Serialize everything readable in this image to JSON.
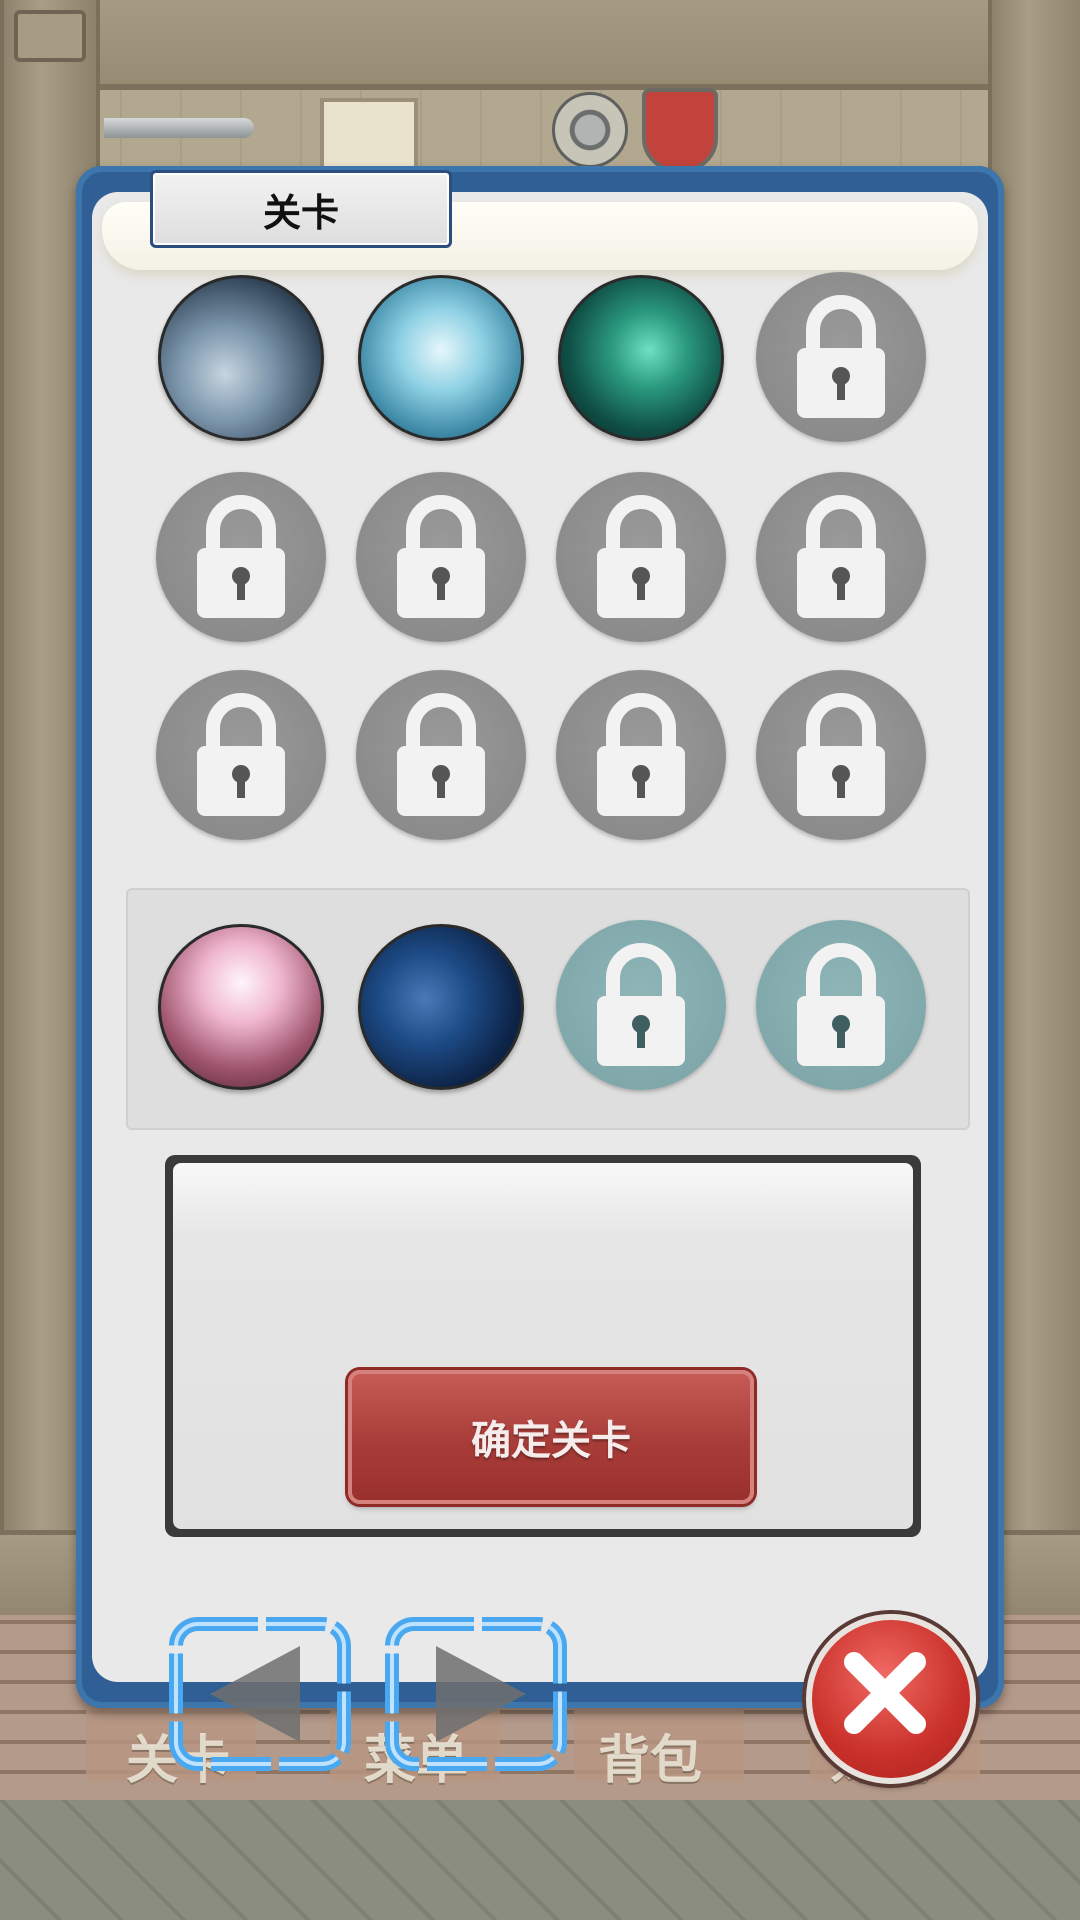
{
  "dialog": {
    "title": "关卡",
    "confirm_label": "确定关卡"
  },
  "levels": [
    {
      "state": "unlocked",
      "theme": "misty-forest"
    },
    {
      "state": "unlocked",
      "theme": "ice-cave"
    },
    {
      "state": "unlocked",
      "theme": "green-cavern"
    },
    {
      "state": "locked"
    },
    {
      "state": "locked"
    },
    {
      "state": "locked"
    },
    {
      "state": "locked"
    },
    {
      "state": "locked"
    },
    {
      "state": "locked"
    },
    {
      "state": "locked"
    },
    {
      "state": "locked"
    },
    {
      "state": "locked"
    }
  ],
  "special_levels": [
    {
      "state": "unlocked",
      "theme": "pink-palace"
    },
    {
      "state": "unlocked",
      "theme": "night-house"
    },
    {
      "state": "locked"
    },
    {
      "state": "locked"
    }
  ],
  "background_tabs": [
    "关卡",
    "菜单",
    "背包",
    "宠物"
  ],
  "colors": {
    "dialog_border": "#2f5f94",
    "confirm_button": "#a83c38",
    "nav_arrow_outline": "#4aa8f0",
    "locked_circle": "#8f8f8f",
    "special_locked_circle": "#84acae"
  },
  "icons": {
    "lock": "lock-icon",
    "prev": "triangle-left-icon",
    "next": "triangle-right-icon",
    "close": "close-x-icon"
  }
}
